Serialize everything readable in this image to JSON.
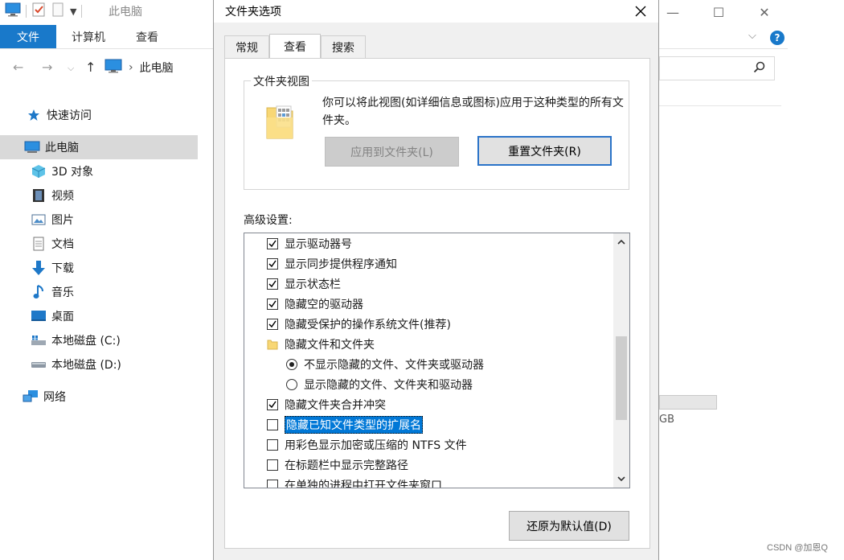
{
  "explorer": {
    "title": "此电脑",
    "ribbon_tabs": [
      "文件",
      "计算机",
      "查看"
    ],
    "breadcrumb": "此电脑",
    "nav": {
      "quick_access": "快速访问",
      "this_pc": "此电脑",
      "objects_3d": "3D 对象",
      "videos": "视频",
      "pictures": "图片",
      "documents": "文档",
      "downloads": "下载",
      "music": "音乐",
      "desktop": "桌面",
      "drive_c": "本地磁盘 (C:)",
      "drive_d": "本地磁盘 (D:)",
      "network": "网络"
    },
    "drive_text_fragment": "GB",
    "help_label": "?"
  },
  "watermark": "CSDN @加恩Q",
  "dialog": {
    "title": "文件夹选项",
    "tabs": [
      "常规",
      "查看",
      "搜索"
    ],
    "active_tab": "查看",
    "folder_views": {
      "legend": "文件夹视图",
      "description": "你可以将此视图(如详细信息或图标)应用于这种类型的所有文件夹。",
      "apply_button": "应用到文件夹(L)",
      "reset_button": "重置文件夹(R)"
    },
    "advanced_label": "高级设置:",
    "settings": [
      {
        "label": "显示驱动器号",
        "type": "checkbox",
        "checked": true
      },
      {
        "label": "显示同步提供程序通知",
        "type": "checkbox",
        "checked": true
      },
      {
        "label": "显示状态栏",
        "type": "checkbox",
        "checked": true
      },
      {
        "label": "隐藏空的驱动器",
        "type": "checkbox",
        "checked": true
      },
      {
        "label": "隐藏受保护的操作系统文件(推荐)",
        "type": "checkbox",
        "checked": true
      },
      {
        "label": "隐藏文件和文件夹",
        "type": "folder"
      },
      {
        "label": "不显示隐藏的文件、文件夹或驱动器",
        "type": "radio",
        "checked": true
      },
      {
        "label": "显示隐藏的文件、文件夹和驱动器",
        "type": "radio",
        "checked": false
      },
      {
        "label": "隐藏文件夹合并冲突",
        "type": "checkbox",
        "checked": true
      },
      {
        "label": "隐藏已知文件类型的扩展名",
        "type": "checkbox",
        "checked": false,
        "selected": true
      },
      {
        "label": "用彩色显示加密或压缩的 NTFS 文件",
        "type": "checkbox",
        "checked": false
      },
      {
        "label": "在标题栏中显示完整路径",
        "type": "checkbox",
        "checked": false
      },
      {
        "label": "在单独的进程中打开文件夹窗口",
        "type": "checkbox",
        "checked": false
      }
    ],
    "restore_defaults_button": "还原为默认值(D)"
  },
  "colors": {
    "accent": "#1979ca",
    "selection": "#0078d7",
    "dialog_bg": "#f0f0f0"
  }
}
